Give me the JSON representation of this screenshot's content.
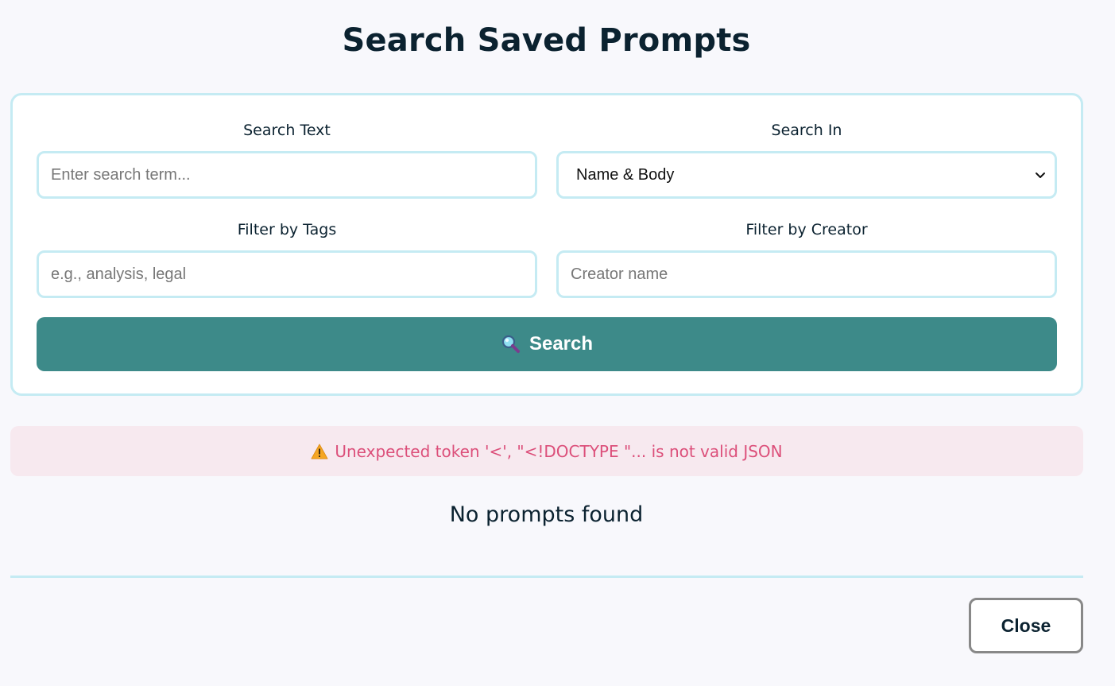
{
  "page": {
    "title": "Search Saved Prompts"
  },
  "form": {
    "search_text": {
      "label": "Search Text",
      "placeholder": "Enter search term...",
      "value": ""
    },
    "search_in": {
      "label": "Search In",
      "selected": "Name & Body"
    },
    "filter_tags": {
      "label": "Filter by Tags",
      "placeholder": "e.g., analysis, legal",
      "value": ""
    },
    "filter_creator": {
      "label": "Filter by Creator",
      "placeholder": "Creator name",
      "value": ""
    },
    "search_button": {
      "label": "Search",
      "icon": "magnifying-glass-icon"
    }
  },
  "error": {
    "icon": "warning-icon",
    "message": "Unexpected token '<', \"<!DOCTYPE \"... is not valid JSON"
  },
  "results": {
    "empty_message": "No prompts found"
  },
  "footer": {
    "close_label": "Close"
  },
  "colors": {
    "accent": "#3d8a89",
    "border": "#c5ebf3",
    "error_text": "#dc4f7a",
    "error_bg": "#f7e9ef"
  }
}
